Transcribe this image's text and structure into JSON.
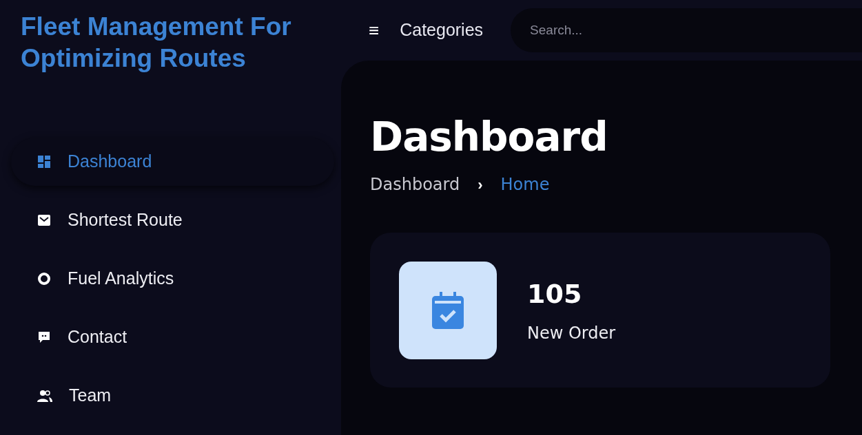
{
  "sidebar": {
    "title": "Fleet Management For Optimizing Routes",
    "items": [
      {
        "label": "Dashboard",
        "selected": true
      },
      {
        "label": "Shortest Route",
        "selected": false
      },
      {
        "label": "Fuel Analytics",
        "selected": false
      },
      {
        "label": "Contact",
        "selected": false
      },
      {
        "label": "Team",
        "selected": false
      }
    ]
  },
  "topbar": {
    "menu": "≡",
    "label": "Categories",
    "search": {
      "placeholder": "Search..."
    }
  },
  "page": {
    "title": "Dashboard",
    "breadcrumb": [
      {
        "label": "Dashboard",
        "selected": false
      },
      {
        "label": "Home",
        "selected": true
      }
    ],
    "separator": "›"
  },
  "stats": [
    {
      "value": "105",
      "label": "New Order"
    }
  ]
}
